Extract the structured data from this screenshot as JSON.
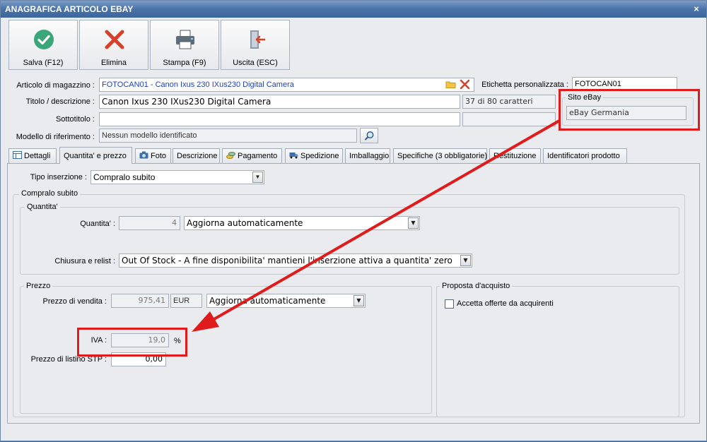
{
  "window": {
    "title": "ANAGRAFICA ARTICOLO EBAY",
    "close_label": "×"
  },
  "toolbar": {
    "save": {
      "label": "Salva (F12)",
      "icon": "check-circle-icon"
    },
    "delete": {
      "label": "Elimina",
      "icon": "red-x-icon"
    },
    "print": {
      "label": "Stampa (F9)",
      "icon": "printer-icon"
    },
    "exit": {
      "label": "Uscita (ESC)",
      "icon": "exit-door-icon"
    }
  },
  "header": {
    "articolo_label": "Articolo di magazzino :",
    "articolo_value": "FOTOCAN01 - Canon Ixus 230 IXus230 Digital Camera",
    "etichetta_label": "Etichetta personalizzata :",
    "etichetta_value": "FOTOCAN01",
    "titolo_label": "Titolo / descrizione :",
    "titolo_value": "Canon Ixus 230 IXus230 Digital Camera",
    "titolo_counter": "37 di 80 caratteri",
    "sottotitolo_label": "Sottotitolo :",
    "sottotitolo_value": "",
    "modello_label": "Modello di riferimento :",
    "modello_value": "Nessun modello identificato",
    "sito_label": "Sito eBay",
    "sito_value": "eBay Germania"
  },
  "tabs": [
    {
      "label": "Dettagli",
      "icon": "table-icon"
    },
    {
      "label": "Quantita' e prezzo",
      "icon": ""
    },
    {
      "label": "Foto",
      "icon": "camera-icon"
    },
    {
      "label": "Descrizione",
      "icon": ""
    },
    {
      "label": "Pagamento",
      "icon": "coins-icon"
    },
    {
      "label": "Spedizione",
      "icon": "truck-icon"
    },
    {
      "label": "Imballaggio",
      "icon": ""
    },
    {
      "label": "Specifiche (3 obbligatorie)",
      "icon": ""
    },
    {
      "label": "Restituzione",
      "icon": ""
    },
    {
      "label": "Identificatori prodotto",
      "icon": ""
    }
  ],
  "panel": {
    "tipo_label": "Tipo inserzione :",
    "tipo_value": "Compralo subito",
    "compralo_group": "Compralo subito",
    "quantita_group": "Quantita'",
    "quantita_label": "Quantita' :",
    "quantita_value": "4",
    "quantita_mode": "Aggiorna automaticamente",
    "chiusura_label": "Chiusura e relist :",
    "chiusura_value": "Out Of Stock - A fine disponibilita' mantieni l'inserzione attiva a quantita' zero",
    "prezzo_group": "Prezzo",
    "prezzo_label": "Prezzo di vendita :",
    "prezzo_value": "975,41",
    "prezzo_currency": "EUR",
    "prezzo_mode": "Aggiorna automaticamente",
    "iva_label": "IVA :",
    "iva_value": "19,0",
    "iva_unit": "%",
    "listino_label": "Prezzo di listino STP :",
    "listino_value": "0,00",
    "proposta_group": "Proposta d'acquisto",
    "accetta_label": "Accetta offerte da acquirenti"
  },
  "colors": {
    "annotation": "#e01b1b",
    "titlebar": "#4a73a8",
    "link_text": "#1f3ec2"
  }
}
